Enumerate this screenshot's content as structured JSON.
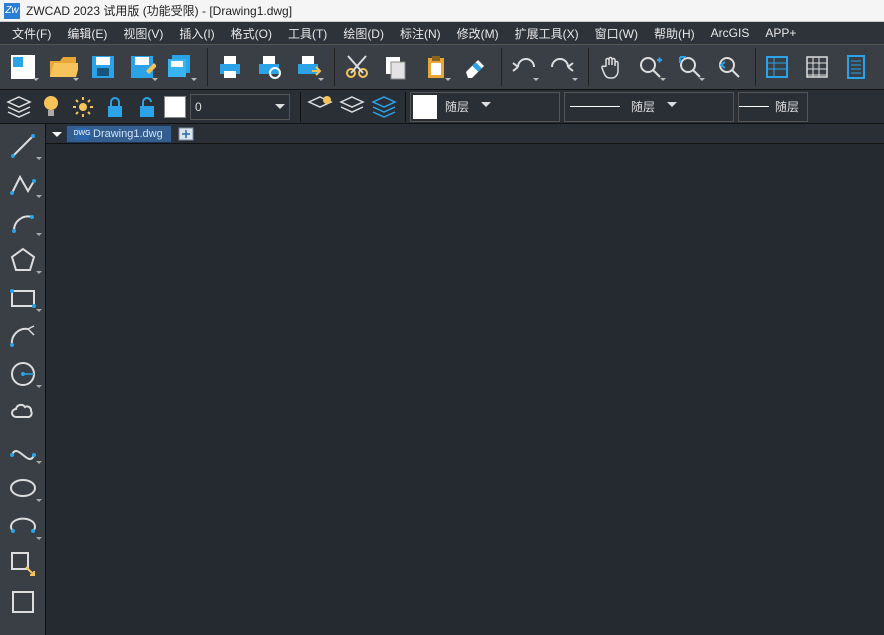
{
  "title": "ZWCAD 2023 试用版 (功能受限) - [Drawing1.dwg]",
  "menu": [
    "文件(F)",
    "编辑(E)",
    "视图(V)",
    "插入(I)",
    "格式(O)",
    "工具(T)",
    "绘图(D)",
    "标注(N)",
    "修改(M)",
    "扩展工具(X)",
    "窗口(W)",
    "帮助(H)",
    "ArcGIS",
    "APP+"
  ],
  "layer_value": "0",
  "color_prop_label": "随层",
  "linetype_prop_label": "随层",
  "lineweight_prop_label": "随层",
  "doc_tab": "Drawing1.dwg",
  "dwg_badge": "DWG"
}
